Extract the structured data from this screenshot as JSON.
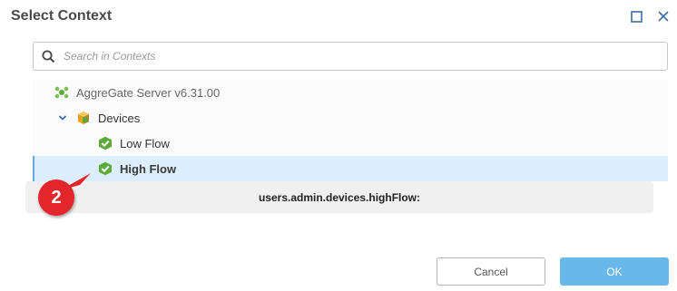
{
  "dialog": {
    "title": "Select Context",
    "maximize_icon": "maximize-icon",
    "close_icon": "close-icon"
  },
  "search": {
    "placeholder": "Search in Contexts",
    "value": "",
    "icon": "search-icon"
  },
  "tree": {
    "root": {
      "label": "AggreGate Server v6.31.00",
      "icon": "server-icon"
    },
    "devices": {
      "label": "Devices",
      "icon": "devices-folder-icon",
      "expanded": true
    },
    "items": [
      {
        "label": "Low Flow",
        "icon": "device-ok-icon",
        "selected": false
      },
      {
        "label": "High Flow",
        "icon": "device-ok-icon",
        "selected": true
      }
    ]
  },
  "path_tooltip": "users.admin.devices.highFlow:",
  "callout": {
    "number": "2",
    "color": "#e3262b"
  },
  "buttons": {
    "cancel": "Cancel",
    "ok": "OK"
  },
  "colors": {
    "accent": "#6ab7ea",
    "selection": "#dceefb",
    "device_ok": "#5aaa3c"
  }
}
